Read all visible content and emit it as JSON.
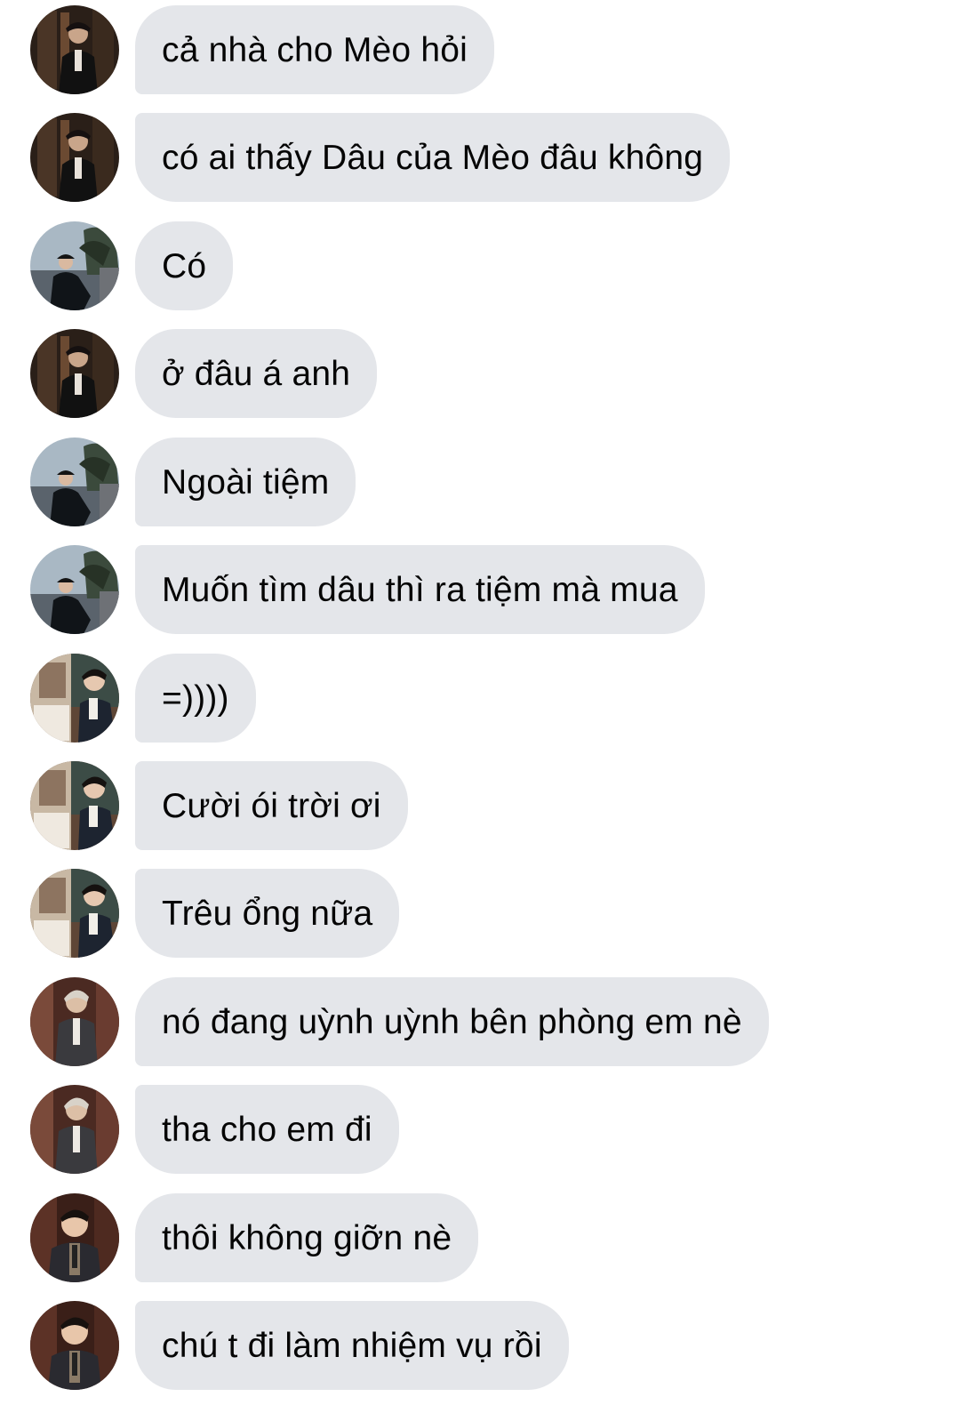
{
  "messages": [
    {
      "text": "cả nhà cho Mèo hỏi",
      "avatar": "avatar-a"
    },
    {
      "text": "có ai thấy Dâu của Mèo đâu không",
      "avatar": "avatar-a"
    },
    {
      "text": "Có",
      "avatar": "avatar-b"
    },
    {
      "text": "ở đâu á anh",
      "avatar": "avatar-a"
    },
    {
      "text": "Ngoài tiệm",
      "avatar": "avatar-b"
    },
    {
      "text": "Muốn tìm dâu thì ra tiệm mà mua",
      "avatar": "avatar-b"
    },
    {
      "text": "=))))",
      "avatar": "avatar-c"
    },
    {
      "text": "Cười ói trời ơi",
      "avatar": "avatar-c"
    },
    {
      "text": "Trêu ổng nữa",
      "avatar": "avatar-c"
    },
    {
      "text": "nó đang uỳnh uỳnh bên phòng em nè",
      "avatar": "avatar-d"
    },
    {
      "text": "tha cho em đi",
      "avatar": "avatar-d"
    },
    {
      "text": "thôi không giỡn nè",
      "avatar": "avatar-e"
    },
    {
      "text": "chú t đi làm nhiệm vụ rồi",
      "avatar": "avatar-e"
    }
  ],
  "colors": {
    "bubble": "#e4e6ea",
    "text": "#050505",
    "background": "#ffffff"
  }
}
